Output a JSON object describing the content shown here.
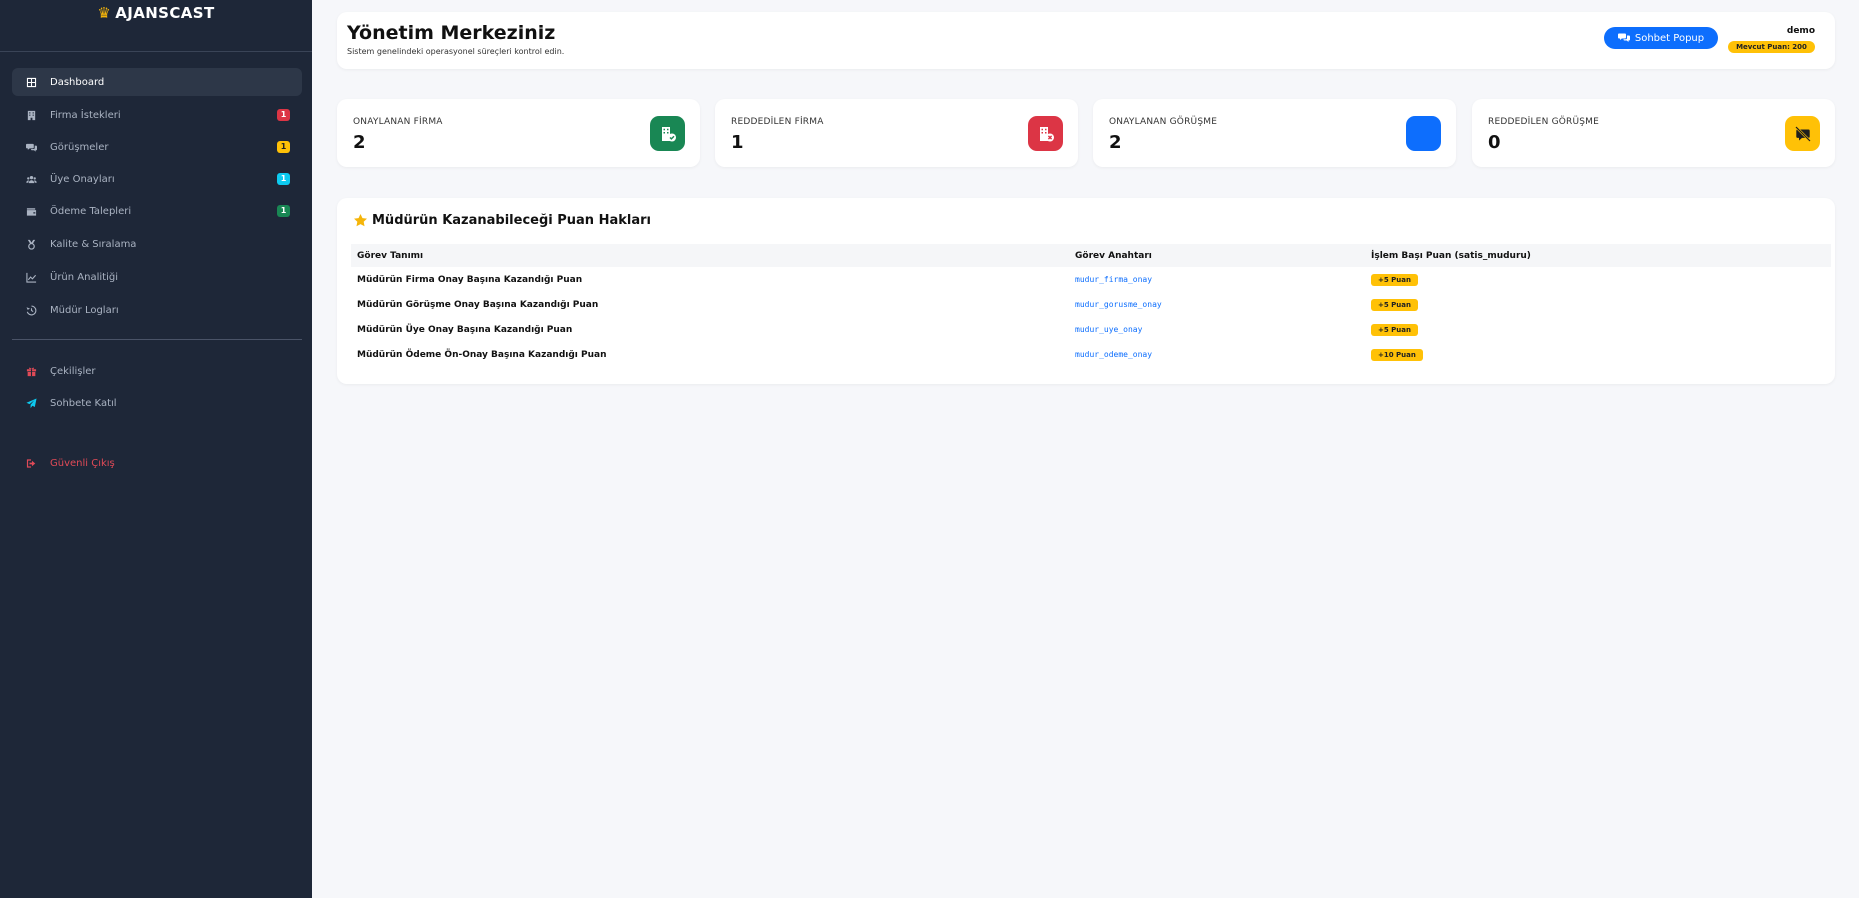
{
  "brand": {
    "name": "AJANSCAST",
    "icon": "crown-icon",
    "accent": "#f5b50a"
  },
  "sidebar": {
    "items": [
      {
        "label": "Dashboard",
        "icon": "grid-icon",
        "active": true,
        "badge": null
      },
      {
        "label": "Firma İstekleri",
        "icon": "building-icon",
        "badge": "1",
        "badge_color": "#dc3545"
      },
      {
        "label": "Görüşmeler",
        "icon": "comments-icon",
        "badge": "1",
        "badge_color": "#ffc107"
      },
      {
        "label": "Üye Onayları",
        "icon": "users-icon",
        "badge": "1",
        "badge_color": "#0dcaf0"
      },
      {
        "label": "Ödeme Talepleri",
        "icon": "wallet-icon",
        "badge": "1",
        "badge_color": "#198754"
      },
      {
        "label": "Kalite & Sıralama",
        "icon": "medal-icon",
        "badge": null
      },
      {
        "label": "Ürün Analitiği",
        "icon": "chart-line-icon",
        "badge": null
      },
      {
        "label": "Müdür Logları",
        "icon": "history-icon",
        "badge": null
      }
    ],
    "extra_items": [
      {
        "label": "Çekilişler",
        "icon": "gift-icon",
        "icon_color": "#e04a57"
      },
      {
        "label": "Sohbete Katıl",
        "icon": "paper-plane-icon",
        "icon_color": "#0dcaf0"
      }
    ],
    "logout": {
      "label": "Güvenli Çıkış",
      "icon": "sign-out-icon",
      "color": "#e04a57"
    }
  },
  "header": {
    "title": "Yönetim Merkeziniz",
    "subtitle": "Sistem genelindeki operasyonel süreçleri kontrol edin.",
    "chat_button": "Sohbet Popup",
    "username": "demo",
    "points": "Mevcut Puan: 200"
  },
  "stats": [
    {
      "label": "ONAYLANAN FİRMA",
      "value": "2",
      "icon": "building-check-icon",
      "color": "#198754"
    },
    {
      "label": "REDDEDİLEN FİRMA",
      "value": "1",
      "icon": "building-x-icon",
      "color": "#dc3545"
    },
    {
      "label": "ONAYLANAN GÖRÜŞME",
      "value": "2",
      "icon": "comment-check-icon",
      "color": "#0d6efd"
    },
    {
      "label": "REDDEDİLEN GÖRÜŞME",
      "value": "0",
      "icon": "comment-slash-icon",
      "color": "#ffc107"
    }
  ],
  "points_table": {
    "title": "Müdürün Kazanabileceği Puan Hakları",
    "icon": "star-icon",
    "headers": [
      "Görev Tanımı",
      "Görev Anahtarı",
      "İşlem Başı Puan (satis_muduru)"
    ],
    "rows": [
      {
        "desc": "Müdürün Firma Onay Başına Kazandığı Puan",
        "key": "mudur_firma_onay",
        "points": "+5 Puan"
      },
      {
        "desc": "Müdürün Görüşme Onay Başına Kazandığı Puan",
        "key": "mudur_gorusme_onay",
        "points": "+5 Puan"
      },
      {
        "desc": "Müdürün Üye Onay Başına Kazandığı Puan",
        "key": "mudur_uye_onay",
        "points": "+5 Puan"
      },
      {
        "desc": "Müdürün Ödeme Ön-Onay Başına Kazandığı Puan",
        "key": "mudur_odeme_onay",
        "points": "+10 Puan"
      }
    ]
  }
}
